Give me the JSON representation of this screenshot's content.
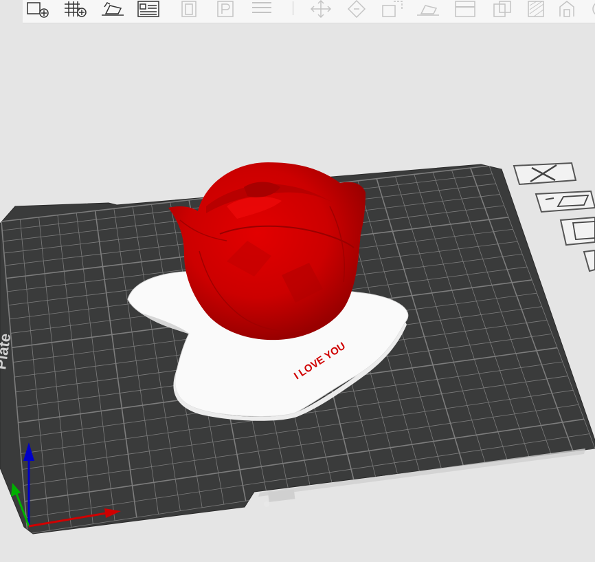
{
  "toolbar": {
    "left_buttons": [
      {
        "name": "add-object-button",
        "icon": "add-object-icon",
        "enabled": true
      },
      {
        "name": "add-plate-button",
        "icon": "add-plate-icon",
        "enabled": true
      },
      {
        "name": "auto-orient-button",
        "icon": "orient-icon",
        "enabled": true
      },
      {
        "name": "arrange-button",
        "icon": "arrange-icon",
        "enabled": true
      },
      {
        "name": "split-objects-button",
        "icon": "split-objects-icon",
        "enabled": false
      },
      {
        "name": "split-parts-button",
        "icon": "split-parts-icon",
        "enabled": false
      },
      {
        "name": "layers-button",
        "icon": "layers-icon",
        "enabled": false
      }
    ],
    "right_buttons": [
      {
        "name": "move-tool-button",
        "icon": "move-icon",
        "enabled": false
      },
      {
        "name": "rotate-tool-button",
        "icon": "rotate-icon",
        "enabled": false
      },
      {
        "name": "scale-tool-button",
        "icon": "scale-icon",
        "enabled": false
      },
      {
        "name": "lay-on-face-button",
        "icon": "lay-on-face-icon",
        "enabled": false
      },
      {
        "name": "cut-tool-button",
        "icon": "cut-icon",
        "enabled": false
      },
      {
        "name": "mesh-boolean-button",
        "icon": "boolean-icon",
        "enabled": false
      },
      {
        "name": "support-paint-button",
        "icon": "support-paint-icon",
        "enabled": false
      },
      {
        "name": "seam-paint-button",
        "icon": "seam-paint-icon",
        "enabled": false
      },
      {
        "name": "measure-button",
        "icon": "measure-icon",
        "enabled": false
      }
    ]
  },
  "scene": {
    "plate_label": "Plate",
    "model_text": "I LOVE YOU",
    "colors": {
      "background": "#e5e5e5",
      "bed": "#3a3b3b",
      "grid_line": "#7d7d7d",
      "model_rose": "#d30000",
      "model_base": "#fafafa",
      "axis_x": "#d00000",
      "axis_y": "#00b000",
      "axis_z": "#0000c8"
    }
  },
  "plate_controls": [
    {
      "name": "delete-plate-button",
      "icon": "close-icon"
    },
    {
      "name": "plate-settings-button",
      "icon": "plate-settings-icon"
    },
    {
      "name": "arrange-plate-button",
      "icon": "arrange-icon"
    },
    {
      "name": "plate-more-button",
      "icon": "chevron-icon"
    }
  ]
}
